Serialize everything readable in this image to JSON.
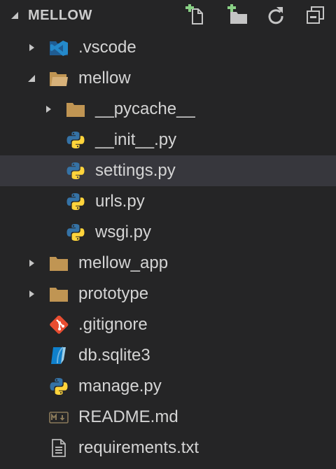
{
  "explorer": {
    "title": "MELLOW",
    "actions": [
      {
        "name": "new-file",
        "icon": "new-file-icon"
      },
      {
        "name": "new-folder",
        "icon": "new-folder-icon"
      },
      {
        "name": "refresh",
        "icon": "refresh-icon"
      },
      {
        "name": "collapse-all",
        "icon": "collapse-all-icon"
      }
    ]
  },
  "colors": {
    "background": "#252526",
    "selected_row": "#37373d",
    "text": "#d4d4d4",
    "folder": "#c09553",
    "add_badge": "#89d185",
    "python_blue": "#3572a5",
    "python_yellow": "#ffd43b",
    "git_red": "#e84d31",
    "vscode_blue": "#2489ca",
    "sqlite_blue": "#0f80cc"
  },
  "tree": [
    {
      "label": ".vscode",
      "depth": 0,
      "kind": "folder",
      "expanded": false,
      "icon": "vscode-folder-icon"
    },
    {
      "label": "mellow",
      "depth": 0,
      "kind": "folder",
      "expanded": true,
      "icon": "folder-open-icon"
    },
    {
      "label": "__pycache__",
      "depth": 1,
      "kind": "folder",
      "expanded": false,
      "icon": "folder-icon"
    },
    {
      "label": "__init__.py",
      "depth": 1,
      "kind": "file",
      "icon": "python-icon"
    },
    {
      "label": "settings.py",
      "depth": 1,
      "kind": "file",
      "icon": "python-icon",
      "selected": true
    },
    {
      "label": "urls.py",
      "depth": 1,
      "kind": "file",
      "icon": "python-icon"
    },
    {
      "label": "wsgi.py",
      "depth": 1,
      "kind": "file",
      "icon": "python-icon"
    },
    {
      "label": "mellow_app",
      "depth": 0,
      "kind": "folder",
      "expanded": false,
      "icon": "folder-icon"
    },
    {
      "label": "prototype",
      "depth": 0,
      "kind": "folder",
      "expanded": false,
      "icon": "folder-icon"
    },
    {
      "label": ".gitignore",
      "depth": 0,
      "kind": "file",
      "icon": "git-icon"
    },
    {
      "label": "db.sqlite3",
      "depth": 0,
      "kind": "file",
      "icon": "database-icon"
    },
    {
      "label": "manage.py",
      "depth": 0,
      "kind": "file",
      "icon": "python-icon"
    },
    {
      "label": "README.md",
      "depth": 0,
      "kind": "file",
      "icon": "markdown-icon"
    },
    {
      "label": "requirements.txt",
      "depth": 0,
      "kind": "file",
      "icon": "text-file-icon"
    }
  ]
}
